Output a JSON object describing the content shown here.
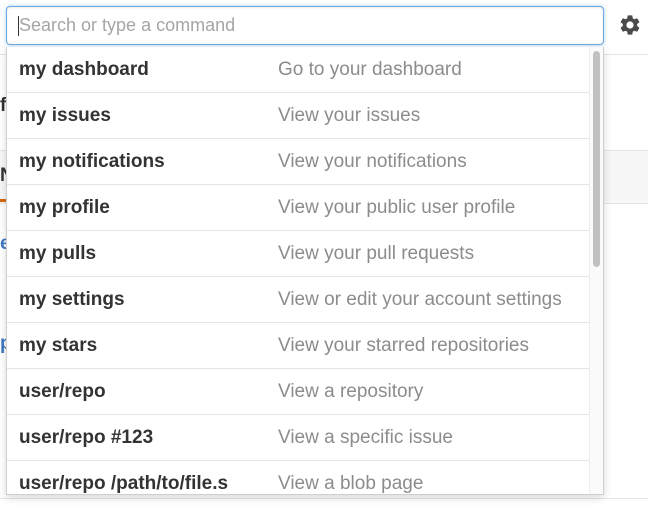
{
  "search": {
    "placeholder": "Search or type a command",
    "value": ""
  },
  "background_fragments": {
    "frag1": "f",
    "frag2": "N",
    "frag3": "e",
    "frag4": "p"
  },
  "commands": [
    {
      "command": "my dashboard",
      "description": "Go to your dashboard"
    },
    {
      "command": "my issues",
      "description": "View your issues"
    },
    {
      "command": "my notifications",
      "description": "View your notifications"
    },
    {
      "command": "my profile",
      "description": "View your public user profile"
    },
    {
      "command": "my pulls",
      "description": "View your pull requests"
    },
    {
      "command": "my settings",
      "description": "View or edit your account settings"
    },
    {
      "command": "my stars",
      "description": "View your starred repositories"
    },
    {
      "command": "user/repo",
      "description": "View a repository"
    },
    {
      "command": "user/repo #123",
      "description": "View a specific issue"
    },
    {
      "command": "user/repo /path/to/file.s",
      "description": "View a blob page"
    }
  ],
  "icons": {
    "settings": "gear-icon"
  },
  "colors": {
    "focus_border": "#6fa8dc",
    "command_text": "#333333",
    "description_text": "#8c8c8c",
    "accent_link": "#4078c0",
    "tab_underline": "#d26911"
  }
}
